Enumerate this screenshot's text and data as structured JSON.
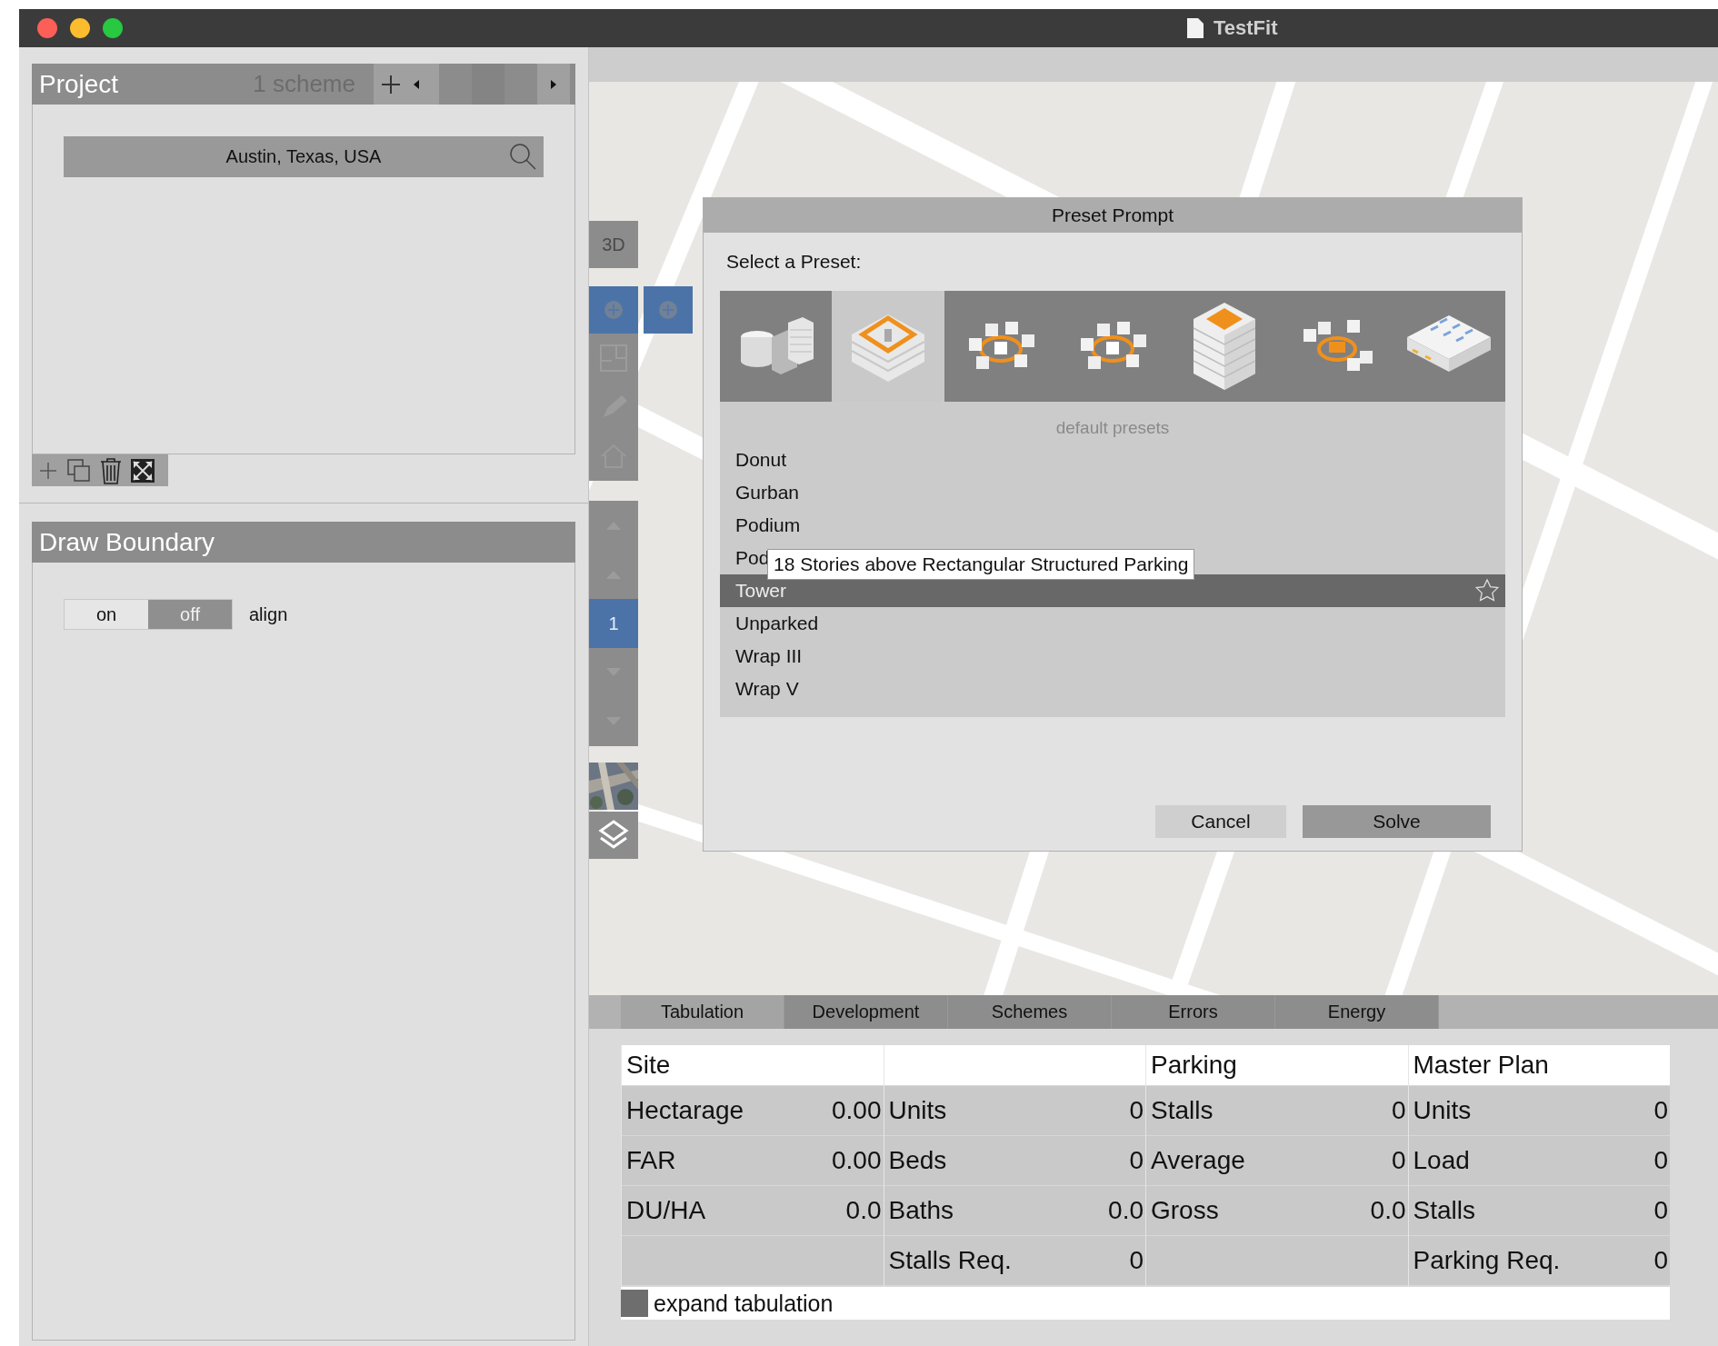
{
  "window": {
    "title": "TestFit"
  },
  "project": {
    "title": "Project",
    "scheme_count": "1 scheme",
    "location": "Austin, Texas, USA"
  },
  "draw_boundary": {
    "title": "Draw Boundary",
    "toggle": [
      {
        "label": "on",
        "selected": false
      },
      {
        "label": "off",
        "selected": true
      }
    ],
    "align_label": "align"
  },
  "map_toolbar": {
    "view_label": "3D",
    "level_label": "1"
  },
  "dialog": {
    "title": "Preset Prompt",
    "prompt": "Select a Preset:",
    "presets": [
      {
        "kind": "campus",
        "selected": false
      },
      {
        "kind": "podium",
        "selected": true
      },
      {
        "kind": "ring",
        "selected": false
      },
      {
        "kind": "ring",
        "selected": false
      },
      {
        "kind": "tower",
        "selected": false
      },
      {
        "kind": "garage-ring",
        "selected": false
      },
      {
        "kind": "warehouse",
        "selected": false
      }
    ],
    "section": "default presets",
    "items": [
      {
        "label": "Donut",
        "selected": false
      },
      {
        "label": "Gurban",
        "selected": false
      },
      {
        "label": "Podium",
        "selected": false
      },
      {
        "label": "Pod",
        "selected": false
      },
      {
        "label": "Tower",
        "selected": true
      },
      {
        "label": "Unparked",
        "selected": false
      },
      {
        "label": "Wrap III",
        "selected": false
      },
      {
        "label": "Wrap V",
        "selected": false
      }
    ],
    "tooltip": "18 Stories above Rectangular Structured Parking",
    "buttons": [
      {
        "label": "Cancel",
        "kind": "secondary"
      },
      {
        "label": "Solve",
        "kind": "primary"
      }
    ]
  },
  "bottom_tabs": [
    {
      "label": "Tabulation",
      "selected": true
    },
    {
      "label": "Development",
      "selected": false
    },
    {
      "label": "Schemes",
      "selected": false
    },
    {
      "label": "Errors",
      "selected": false
    },
    {
      "label": "Energy",
      "selected": false
    }
  ],
  "tabulation": {
    "groups": [
      {
        "title": "Site",
        "rows": [
          {
            "label": "Hectarage",
            "value": "0.00"
          },
          {
            "label": "FAR",
            "value": "0.00"
          },
          {
            "label": "DU/HA",
            "value": "0.0"
          }
        ]
      },
      {
        "rows": [
          {
            "label": "Units",
            "value": "0"
          },
          {
            "label": "Beds",
            "value": "0"
          },
          {
            "label": "Baths",
            "value": "0.0"
          },
          {
            "label": "Stalls Req.",
            "value": "0"
          }
        ]
      },
      {
        "title": "Parking",
        "rows": [
          {
            "label": "Stalls",
            "value": "0"
          },
          {
            "label": "Average",
            "value": "0"
          },
          {
            "label": "Gross",
            "value": "0.0"
          }
        ]
      },
      {
        "title": "Master Plan",
        "rows": [
          {
            "label": "Units",
            "value": "0"
          },
          {
            "label": "Load",
            "value": "0"
          },
          {
            "label": "Stalls",
            "value": "0"
          },
          {
            "label": "Parking Req.",
            "value": "0"
          }
        ]
      }
    ],
    "expand_label": "expand tabulation"
  }
}
